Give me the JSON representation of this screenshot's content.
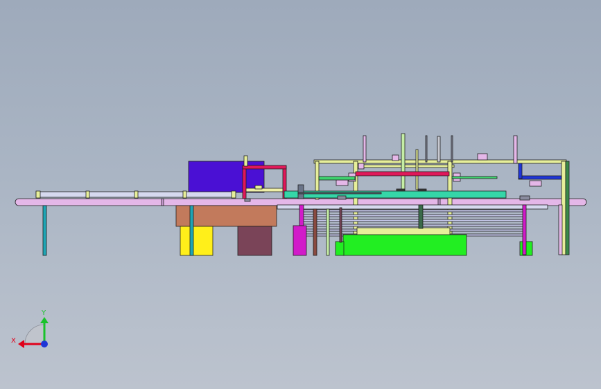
{
  "triad": {
    "x_label": "X",
    "y_label": "Y",
    "x_color": "#e0001a",
    "y_color": "#19c22a",
    "z_color": "#1f35d6"
  },
  "colors": {
    "background_top": "#9eaabb",
    "background_bottom": "#bcc3ce",
    "outline": "#1e1e1e",
    "conveyor_roller": "#e4b7e8",
    "frame_yellow": "#e7ef9a",
    "frame_green": "#22ee22",
    "cabinet_blue": "#4a10d4",
    "crimson": "#e0185a",
    "magenta": "#d11bc9",
    "brown_block": "#c27a5c",
    "maroon_block": "#7a4458",
    "yellow_block": "#ffef1a",
    "teal_leg": "#1fa5b5",
    "cyan_bar": "#35d6a8",
    "slat_blue": "#c4c6e8",
    "rail_light": "#d6d9ef"
  }
}
